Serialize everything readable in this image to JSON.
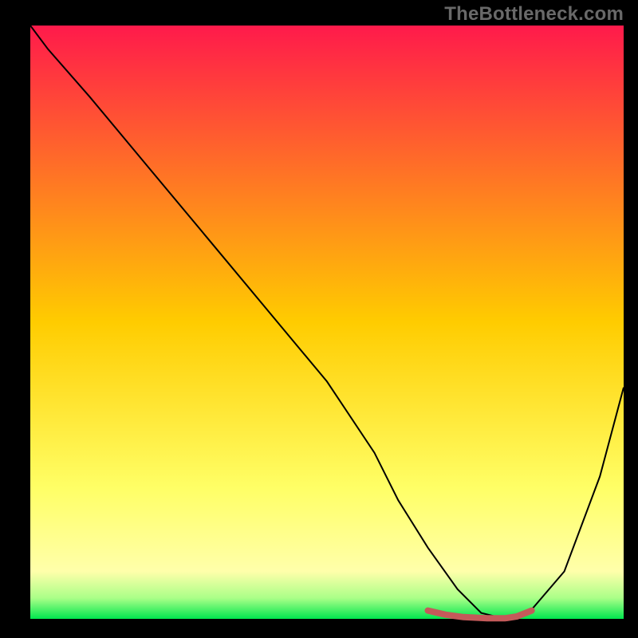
{
  "watermark": "TheBottleneck.com",
  "chart_data": {
    "type": "line",
    "title": "",
    "xlabel": "",
    "ylabel": "",
    "xlim": [
      0,
      100
    ],
    "ylim": [
      0,
      100
    ],
    "grid": false,
    "legend": false,
    "background": {
      "type": "vertical-gradient",
      "stops": [
        {
          "pos": 0.0,
          "color": "#ff1a4b"
        },
        {
          "pos": 0.5,
          "color": "#ffcc00"
        },
        {
          "pos": 0.78,
          "color": "#ffff66"
        },
        {
          "pos": 0.92,
          "color": "#ffffaa"
        },
        {
          "pos": 0.965,
          "color": "#aaff88"
        },
        {
          "pos": 1.0,
          "color": "#00e74e"
        }
      ]
    },
    "series": [
      {
        "name": "bottleneck-curve",
        "color": "#000000",
        "width": 2,
        "x": [
          0,
          3,
          10,
          20,
          30,
          40,
          50,
          58,
          62,
          67,
          72,
          76,
          80,
          84,
          90,
          96,
          100
        ],
        "y": [
          100,
          96,
          88,
          76,
          64,
          52,
          40,
          28,
          20,
          12,
          5,
          1,
          0,
          1,
          8,
          24,
          39
        ]
      },
      {
        "name": "optimal-zone-marker",
        "color": "#c45a5a",
        "width": 8,
        "x": [
          67,
          70,
          73,
          77,
          80,
          82,
          84.5
        ],
        "y": [
          1.4,
          0.7,
          0.3,
          0.1,
          0.1,
          0.4,
          1.4
        ]
      }
    ],
    "annotations": []
  }
}
